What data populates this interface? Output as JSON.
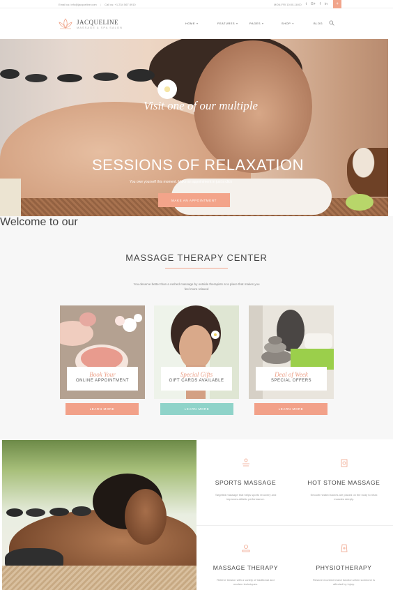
{
  "topbar": {
    "email": "Email us: info@jacqueline.com",
    "phone": "Call us: +1 234 567 8910",
    "hours": "MON-FRI 10:00-18:00",
    "social": [
      "t",
      "G+",
      "f",
      "in"
    ],
    "accent_icon": "+"
  },
  "header": {
    "logo_name": "JACQUELINE",
    "logo_tag": "MASSAGE & SPA SALON",
    "nav": [
      "HOME",
      "FEATURES",
      "PAGES",
      "SHOP",
      "BLOG"
    ]
  },
  "hero": {
    "script": "Visit one of our multiple",
    "title": "SESSIONS OF RELAXATION",
    "subtitle": "You owe yourself this moment. Make an appointment in just a click",
    "cta": "MAKE AN APPOINTMENT"
  },
  "about": {
    "welcome": "Welcome to our",
    "title": "MASSAGE THERAPY CENTER",
    "description": "You deserve better than a rushed massage by outside therapists at a place that makes you feel more relaxed"
  },
  "cards": [
    {
      "script": "Book Your",
      "label": "ONLINE APPOINTMENT",
      "button": "LEARN MORE",
      "button_color": "#f2a189"
    },
    {
      "script": "Special Gifts",
      "label": "GIFT CARDS AVAILABLE",
      "button": "LEARN MORE",
      "button_color": "#8fd3c9"
    },
    {
      "script": "Deal of Week",
      "label": "SPECIAL OFFERS",
      "button": "LEARN MORE",
      "button_color": "#f2a189"
    }
  ],
  "services": [
    {
      "icon": "massage-icon",
      "title": "SPORTS MASSAGE",
      "text": "Targeted massage that helps sports recovery and improves athletic performance."
    },
    {
      "icon": "hot-stone-icon",
      "title": "HOT STONE MASSAGE",
      "text": "Smooth heated stones are placed on the body to relax muscles deeply."
    },
    {
      "icon": "therapy-icon",
      "title": "MASSAGE THERAPY",
      "text": "Relieve tension with a variety of traditional and modern techniques."
    },
    {
      "icon": "physio-icon",
      "title": "PHYSIOTHERAPY",
      "text": "Restore movement and function when someone is affected by injury."
    }
  ],
  "colors": {
    "accent": "#f3a48a",
    "teal": "#8fd3c9",
    "light_bg": "#f7f7f7"
  }
}
